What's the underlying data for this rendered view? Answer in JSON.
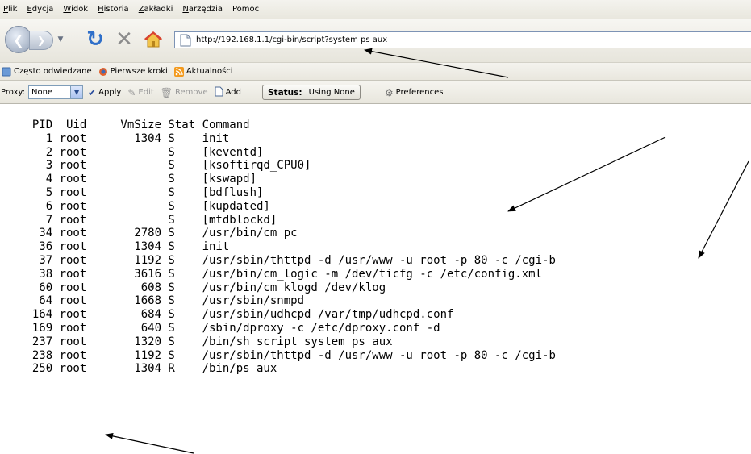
{
  "menu": [
    {
      "u": "P",
      "rest": "lik"
    },
    {
      "u": "E",
      "rest": "dycja"
    },
    {
      "u": "W",
      "rest": "idok"
    },
    {
      "u": "H",
      "rest": "istoria"
    },
    {
      "u": "Z",
      "rest": "akładki"
    },
    {
      "u": "N",
      "rest": "arzędzia"
    },
    {
      "u": "",
      "rest": "Pomoc"
    }
  ],
  "nav": {
    "url": "http://192.168.1.1/cgi-bin/script?system ps aux"
  },
  "bookmarks": {
    "b1": "Często odwiedzane",
    "b2": "Pierwsze kroki",
    "b3": "Aktualności"
  },
  "proxybar": {
    "label": "Proxy:",
    "selected": "None",
    "apply": "Apply",
    "edit": "Edit",
    "remove": "Remove",
    "add": "Add",
    "status_label": "Status:",
    "status_value": "Using None",
    "preferences": "Preferences"
  },
  "ps_output": {
    "header": "  PID  Uid     VmSize Stat Command",
    "rows": [
      "    1 root       1304 S    init",
      "    2 root            S    [keventd]",
      "    3 root            S    [ksoftirqd_CPU0]",
      "    4 root            S    [kswapd]",
      "    5 root            S    [bdflush]",
      "    6 root            S    [kupdated]",
      "    7 root            S    [mtdblockd]",
      "   34 root       2780 S    /usr/bin/cm_pc",
      "   36 root       1304 S    init",
      "   37 root       1192 S    /usr/sbin/thttpd -d /usr/www -u root -p 80 -c /cgi-b",
      "   38 root       3616 S    /usr/bin/cm_logic -m /dev/ticfg -c /etc/config.xml",
      "   60 root        608 S    /usr/bin/cm_klogd /dev/klog",
      "   64 root       1668 S    /usr/sbin/snmpd",
      "  164 root        684 S    /usr/sbin/udhcpd /var/tmp/udhcpd.conf",
      "  169 root        640 S    /sbin/dproxy -c /etc/dproxy.conf -d",
      "  237 root       1320 S    /bin/sh script system ps aux",
      "  238 root       1192 S    /usr/sbin/thttpd -d /usr/www -u root -p 80 -c /cgi-b",
      "  250 root       1304 R    /bin/ps aux"
    ]
  }
}
